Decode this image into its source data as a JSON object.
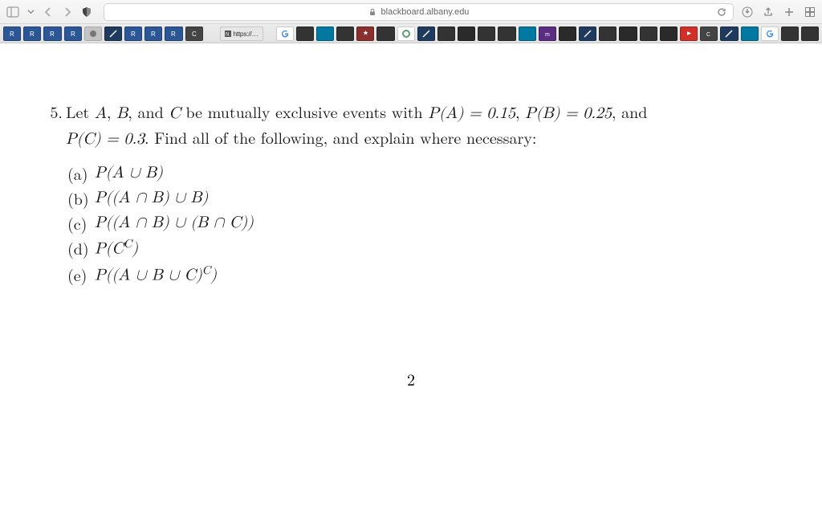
{
  "browser": {
    "url_display": "blackboard.albany.edu",
    "https_bookmark_label": "https://…"
  },
  "question": {
    "number": "5.",
    "stem_plain_1": "Let ",
    "stem_var_A": "A",
    "stem_comma1": ", ",
    "stem_var_B": "B",
    "stem_comma2": ", and ",
    "stem_var_C": "C",
    "stem_plain_2": " be mutually exclusive events with ",
    "stem_PA": "P(A) = 0.15",
    "stem_comma3": ", ",
    "stem_PB": "P(B) = 0.25",
    "stem_comma4": ", and ",
    "stem_PC": "P(C) = 0.3",
    "stem_tail": ". Find all of the following, and explain where necessary:",
    "parts": {
      "a": {
        "label": "(a)",
        "expr": "P(A ∪ B)"
      },
      "b": {
        "label": "(b)",
        "expr": "P((A ∩ B) ∪ B)"
      },
      "c": {
        "label": "(c)",
        "expr": "P((A ∩ B) ∪ (B ∩ C))"
      },
      "d": {
        "label": "(d)",
        "expr_base": "P(C",
        "expr_sup": "C",
        "expr_close": ")"
      },
      "e": {
        "label": "(e)",
        "expr_base": "P((A ∪ B ∪ C)",
        "expr_sup": "C",
        "expr_close": ")"
      }
    }
  },
  "page_number": "2"
}
